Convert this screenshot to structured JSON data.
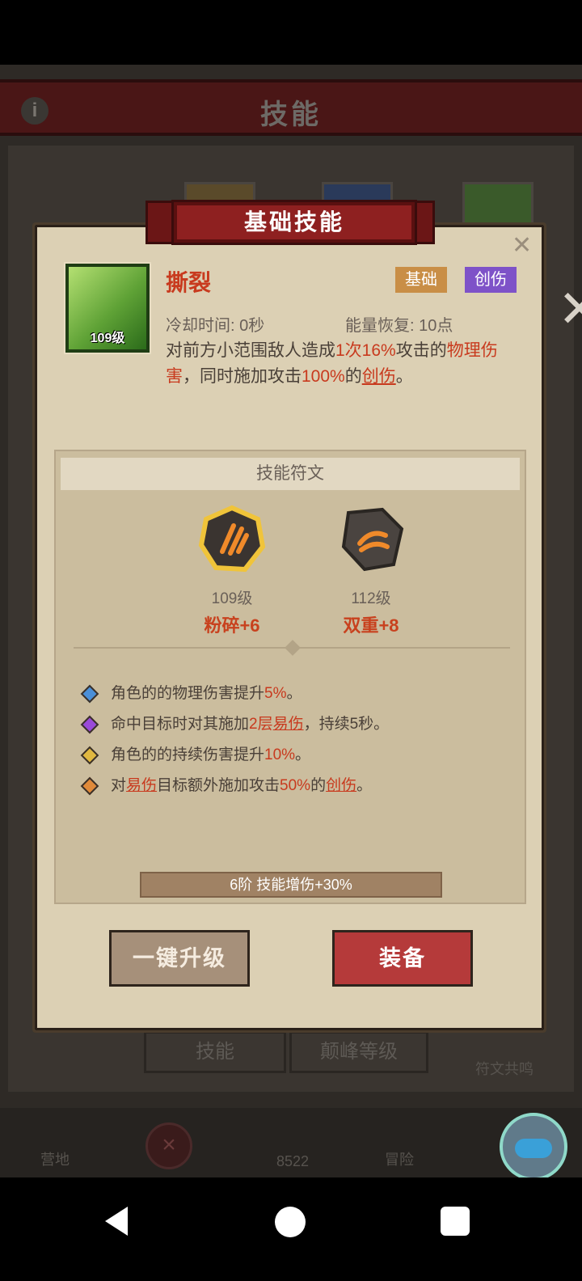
{
  "background": {
    "title": "技能",
    "info_icon": "info-icon",
    "tabs": [
      "技能",
      "颠峰等级"
    ],
    "rune_resonance_label": "符文共鸣",
    "nav": {
      "camp_label": "营地",
      "adventure_label": "冒险",
      "currency_value": "8522"
    }
  },
  "modal": {
    "header": "基础技能",
    "skill": {
      "name": "撕裂",
      "level": "109级",
      "tags": [
        "基础",
        "创伤"
      ],
      "cooldown": "冷却时间: 0秒",
      "energy": "能量恢复: 10点",
      "desc_parts": {
        "p1": "对前方小范围敌人造成",
        "p2": "1次16%",
        "p3": "攻击的",
        "p4": "物理伤害",
        "p5": "，同时施加攻击",
        "p6": "100%",
        "p7": "的",
        "p8": "创伤",
        "p9": "。"
      }
    },
    "runes": {
      "section_title": "技能符文",
      "items": [
        {
          "level": "109级",
          "name": "粉碎+6",
          "color": "#f0b83a"
        },
        {
          "level": "112级",
          "name": "双重+8",
          "color": "#4a4440"
        }
      ],
      "effects": [
        {
          "color": "#4a8fd8",
          "a": "角色的的物理伤害提升",
          "b": "5%",
          "c": "。"
        },
        {
          "color": "#9a4ad8",
          "a": "命中目标时对其施加",
          "b": "2层",
          "u": "易伤",
          "c": "，持续5秒。"
        },
        {
          "color": "#e0b840",
          "a": "角色的的持续伤害提升",
          "b": "10%",
          "c": "。"
        },
        {
          "color": "#e08a3a",
          "a": "对",
          "u": "易伤",
          "a2": "目标额外施加攻击",
          "b": "50%",
          "a3": "的",
          "u2": "创伤",
          "c": "。"
        }
      ],
      "stage_bonus": "6阶 技能增伤+30%"
    },
    "buttons": {
      "upgrade": "一键升级",
      "equip": "装备"
    }
  }
}
